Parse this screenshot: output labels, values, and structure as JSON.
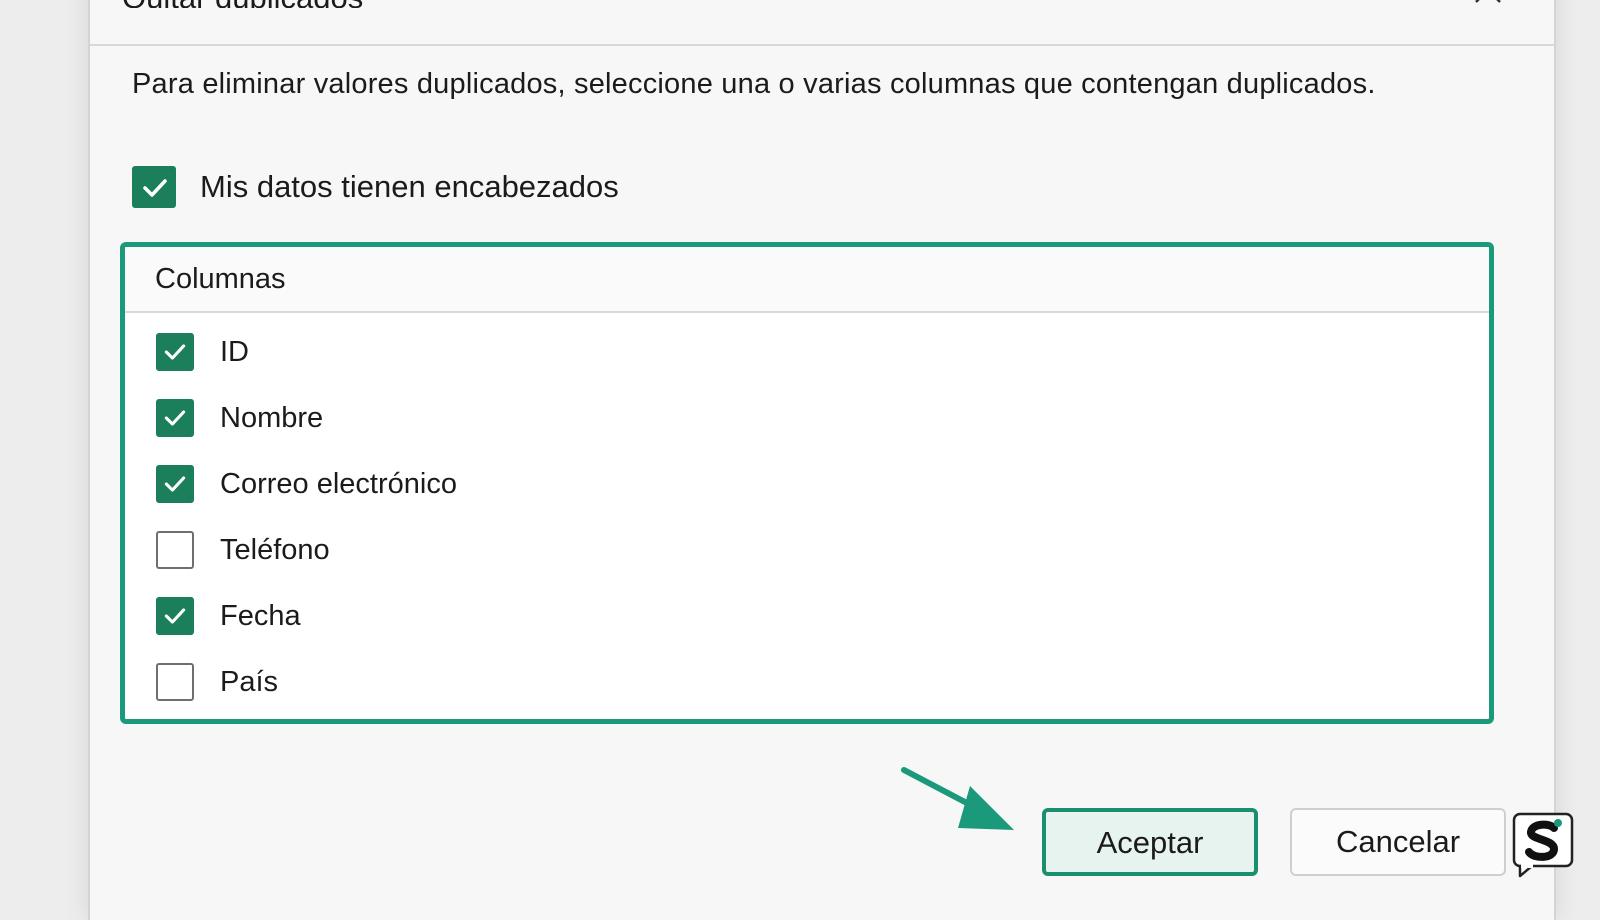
{
  "dialog": {
    "title": "Quitar duplicados",
    "description": "Para eliminar valores duplicados, seleccione una o varias columnas que contengan duplicados.",
    "has_headers": {
      "label": "Mis datos tienen encabezados",
      "checked": true
    },
    "columns_header": "Columnas",
    "columns": [
      {
        "label": "ID",
        "checked": true
      },
      {
        "label": "Nombre",
        "checked": true
      },
      {
        "label": "Correo electrónico",
        "checked": true
      },
      {
        "label": "Teléfono",
        "checked": false
      },
      {
        "label": "Fecha",
        "checked": true
      },
      {
        "label": "País",
        "checked": false
      }
    ],
    "ok_label": "Aceptar",
    "cancel_label": "Cancelar"
  },
  "colors": {
    "accent": "#1a9a7b",
    "checkbox_fill": "#1a7f5a",
    "arrow": "#1a9a7b"
  },
  "icons": {
    "close": "close-icon",
    "check": "checkmark-icon",
    "arrow": "arrow-pointer-icon",
    "logo": "s-logo-icon"
  }
}
